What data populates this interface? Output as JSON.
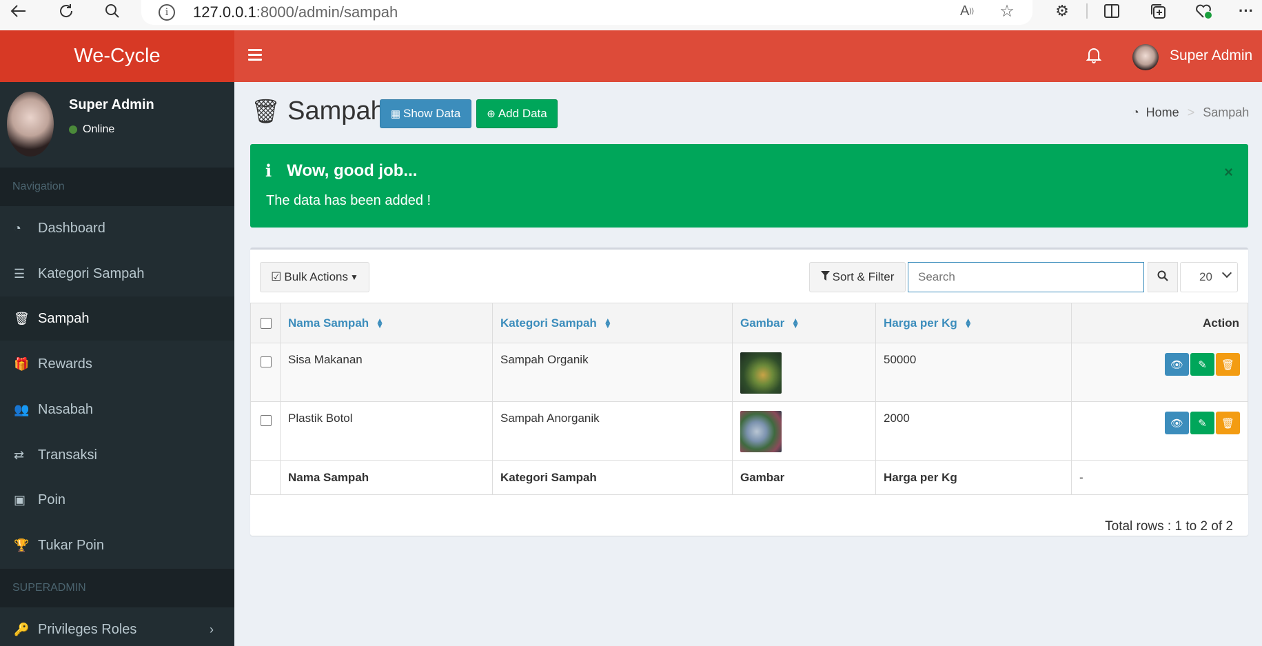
{
  "browser": {
    "url_host": "127.0.0.1",
    "url_path": ":8000/admin/sampah"
  },
  "app": {
    "logo": "We-Cycle",
    "user": {
      "name": "Super Admin",
      "status": "Online"
    },
    "topbar": {
      "user_name": "Super Admin"
    }
  },
  "sidebar": {
    "header_nav": "Navigation",
    "header_super": "SUPERADMIN",
    "items": [
      {
        "label": "Dashboard",
        "icon": "dashboard-icon"
      },
      {
        "label": "Kategori Sampah",
        "icon": "list-icon"
      },
      {
        "label": "Sampah",
        "icon": "trash-icon"
      },
      {
        "label": "Rewards",
        "icon": "gift-icon"
      },
      {
        "label": "Nasabah",
        "icon": "users-icon"
      },
      {
        "label": "Transaksi",
        "icon": "exchange-icon"
      },
      {
        "label": "Poin",
        "icon": "money-icon"
      },
      {
        "label": "Tukar Poin",
        "icon": "trophy-icon"
      },
      {
        "label": "Privileges Roles",
        "icon": "key-icon"
      }
    ]
  },
  "page": {
    "title": "Sampah",
    "show_data": "Show Data",
    "add_data": "Add Data",
    "breadcrumb": {
      "home": "Home",
      "current": "Sampah",
      "separator": ">"
    }
  },
  "alert": {
    "title": "Wow, good job...",
    "message": "The data has been added !",
    "close": "×"
  },
  "toolbar": {
    "bulk_actions": "Bulk Actions",
    "sort_filter": "Sort & Filter",
    "search_placeholder": "Search",
    "per_page": "20"
  },
  "table": {
    "headers": [
      "Nama Sampah",
      "Kategori Sampah",
      "Gambar",
      "Harga per Kg",
      "Action"
    ],
    "rows": [
      {
        "nama": "Sisa Makanan",
        "kategori": "Sampah Organik",
        "harga": "50000"
      },
      {
        "nama": "Plastik Botol",
        "kategori": "Sampah Anorganik",
        "harga": "2000"
      }
    ],
    "footer": [
      "Nama Sampah",
      "Kategori Sampah",
      "Gambar",
      "Harga per Kg",
      "-"
    ],
    "total": "Total rows : 1 to 2 of 2"
  },
  "colors": {
    "brand_dark": "#d73925",
    "brand": "#dd4b39",
    "sidebar": "#222d32",
    "primary": "#3c8dbc",
    "success": "#00a65a",
    "warning": "#f39c12"
  }
}
